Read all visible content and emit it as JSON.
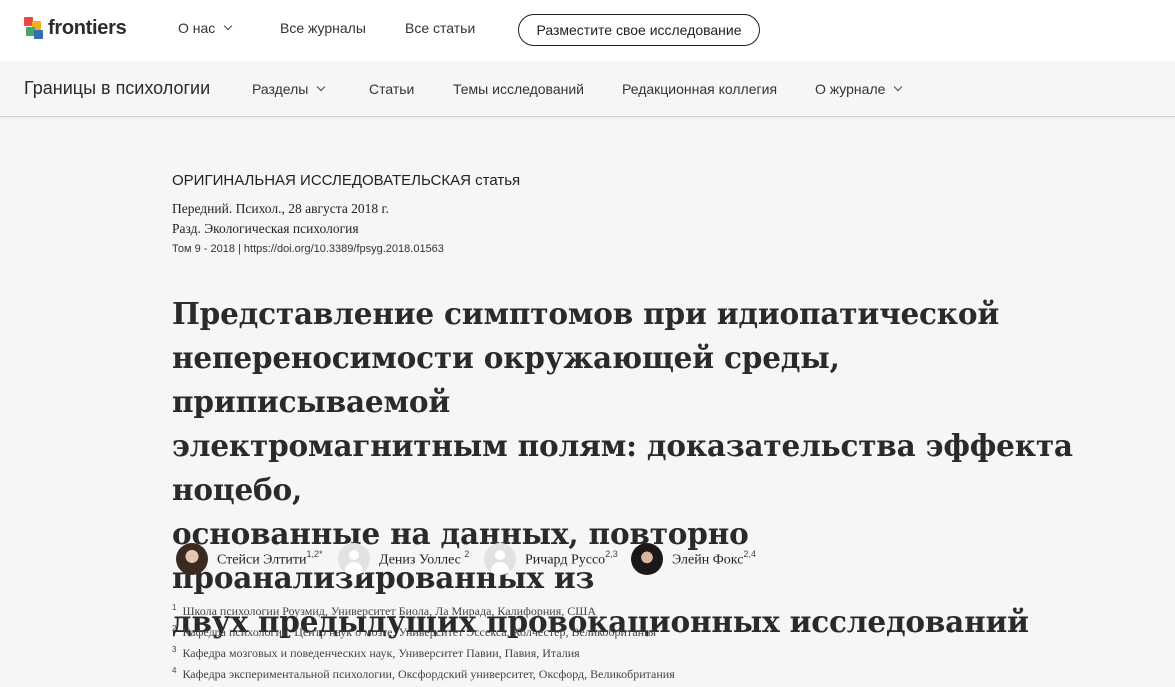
{
  "topnav": {
    "logo_text": "frontiers",
    "items": [
      "О нас",
      "Все журналы",
      "Все статьи"
    ],
    "submit_button": "Разместите свое исследование"
  },
  "journalnav": {
    "title": "Границы в психологии",
    "items": [
      "Разделы",
      "Статьи",
      "Темы исследований",
      "Редакционная коллегия",
      "О журнале"
    ]
  },
  "article": {
    "type": "ОРИГИНАЛЬНАЯ ИССЛЕДОВАТЕЛЬСКАЯ статья",
    "journal_date": "Передний. Психол., 28 августа 2018 г.",
    "section": "Разд. Экологическая психология",
    "volume_doi": "Том 9 - 2018 | https://doi.org/10.3389/fpsyg.2018.01563",
    "title_lines": [
      "Представление симптомов при идиопатической",
      "непереносимости окружающей среды, приписываемой",
      "электромагнитным полям: доказательства эффекта ноцебо,",
      "основанные на данных, повторно проанализированных из",
      "двух предыдущих провокационных исследований"
    ],
    "authors": [
      {
        "name": "Стейси Элтити",
        "sup": "1,2*"
      },
      {
        "name": "Дениз Уоллес ",
        "sup": "2"
      },
      {
        "name": "Ричард Руссо",
        "sup": "2,3"
      },
      {
        "name": "Элейн Фокс",
        "sup": "2,4"
      }
    ],
    "affiliations": [
      {
        "num": "1",
        "text": "Школа психологии Роузмид, Университет Биола, Ла Мирада, Калифорния, США"
      },
      {
        "num": "2",
        "text": "Кафедра психологии, Центр наук о мозге, Университет Эссекса, Колчестер, Великобритания"
      },
      {
        "num": "3",
        "text": "Кафедра мозговых и поведенческих наук, Университет Павии, Павия, Италия"
      },
      {
        "num": "4",
        "text": "Кафедра экспериментальной психологии, Оксфордский университет, Оксфорд, Великобритания"
      }
    ]
  },
  "colors": {
    "logo_squares": [
      "#e8483f",
      "#f2b01e",
      "#4aa564",
      "#2f6fb6"
    ]
  }
}
